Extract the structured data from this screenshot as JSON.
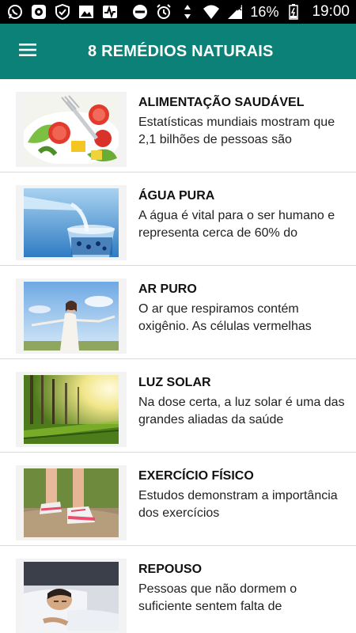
{
  "status_bar": {
    "battery": "16%",
    "time": "19:00",
    "left_icons": [
      "whatsapp-icon",
      "app-notification-icon",
      "shield-icon",
      "image-icon",
      "activity-icon"
    ],
    "right_icons": [
      "do-not-disturb-icon",
      "alarm-icon",
      "data-arrows-icon",
      "wifi-icon",
      "signal-icon",
      "battery-icon"
    ]
  },
  "app_bar": {
    "title": "8 REMÉDIOS NATURAIS",
    "background": "#0b8177",
    "menu_icon": "hamburger-menu-icon"
  },
  "items": [
    {
      "title": "ALIMENTAÇÃO SAUDÁVEL",
      "description": "Estatísticas mundiais mostram que 2,1 bilhões de pessoas são",
      "image": "salad-photo"
    },
    {
      "title": "ÁGUA PURA",
      "description": "A água é vital para o ser humano e representa cerca de 60% do",
      "image": "water-glass-photo"
    },
    {
      "title": "AR PURO",
      "description": "O ar que respiramos contém oxigênio. As células vermelhas",
      "image": "woman-sky-photo"
    },
    {
      "title": "LUZ SOLAR",
      "description": "Na dose certa, a luz solar é uma das grandes aliadas da saúde",
      "image": "sunlight-forest-photo"
    },
    {
      "title": "EXERCÍCIO FÍSICO",
      "description": "Estudos demonstram a importância dos exercícios",
      "image": "running-shoes-photo"
    },
    {
      "title": "REPOUSO",
      "description": "Pessoas que não dormem o suficiente sentem falta de",
      "image": "sleeping-man-photo"
    }
  ]
}
